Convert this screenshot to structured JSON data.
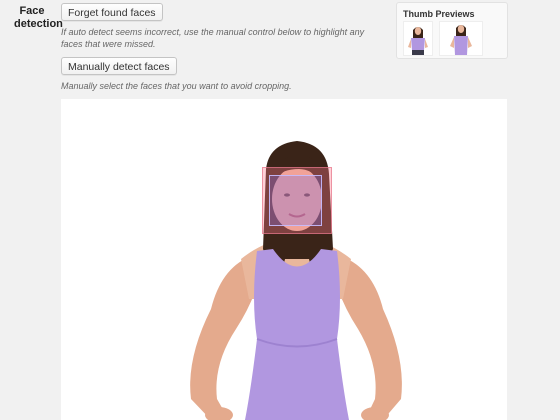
{
  "field": {
    "label": "Face detection"
  },
  "actions": {
    "forget_label": "Forget found faces",
    "forget_desc": "If auto detect seems incorrect, use the manual control below to highlight any faces that were missed.",
    "manual_label": "Manually detect faces",
    "manual_desc": "Manually select the faces that you want to avoid cropping."
  },
  "thumbs": {
    "title": "Thumb Previews"
  },
  "colors": {
    "top": "#b197e0",
    "hair": "#3a2418",
    "skin": "#e9b79c",
    "face_highlight_outer": "#ff788c",
    "face_highlight_inner": "#786ee6"
  }
}
